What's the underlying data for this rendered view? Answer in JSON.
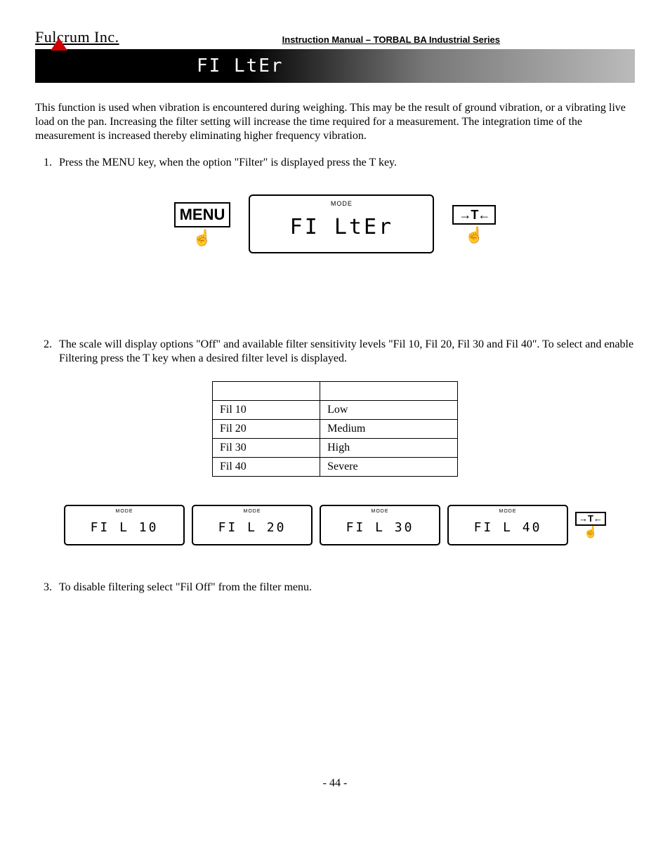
{
  "header": {
    "company": "Fulcrum Inc.",
    "manual_title": "Instruction Manual – TORBAL BA Industrial Series"
  },
  "banner": {
    "title_seg": "FI LtEr"
  },
  "intro": "This function is used when vibration is encountered during weighing.  This may be the result of ground vibration, or a vibrating live load on the pan.  Increasing the filter setting will increase the time required for a measurement.  The integration time of the measurement is increased thereby eliminating higher frequency vibration.",
  "steps": {
    "s1": "Press the MENU key, when the option \"Filter\" is displayed press the T key.",
    "s2": "The scale will display options \"Off\" and available filter sensitivity levels \"Fil 10, Fil 20, Fil 30 and Fil 40\".  To select and enable Filtering press the T key when a desired filter level is displayed.",
    "s3": "To disable filtering select \"Fil Off\" from the filter menu."
  },
  "keys": {
    "menu": "MENU",
    "t": "→T←",
    "mode": "MODE"
  },
  "lcd1": "FI LtEr",
  "table": {
    "r1c1": "Fil 10",
    "r1c2": "Low",
    "r2c1": "Fil 20",
    "r2c2": "Medium",
    "r3c1": "Fil 30",
    "r3c2": "High",
    "r4c1": "Fil 40",
    "r4c2": "Severe"
  },
  "lcds": {
    "a": "FI L  10",
    "b": "FI L  20",
    "c": "FI L  30",
    "d": "FI L  40"
  },
  "page": "- 44 -"
}
